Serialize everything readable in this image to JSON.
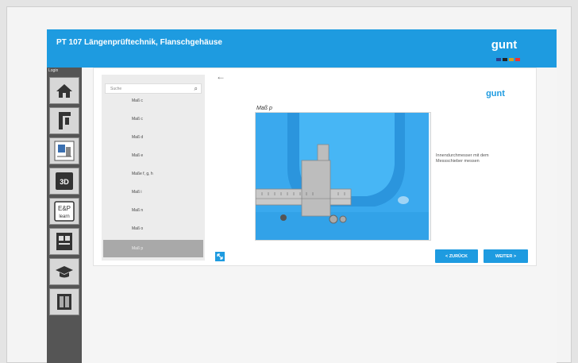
{
  "header": {
    "title": "PT 107 Längenprüftechnik, Flanschgehäuse",
    "logo_text": "gunt"
  },
  "sidebar": {
    "top_label": "Login",
    "items": [
      {
        "icon": "home-icon"
      },
      {
        "icon": "caliper-icon"
      },
      {
        "icon": "drawing-icon"
      },
      {
        "icon": "3d-icon",
        "label": "3D"
      },
      {
        "icon": "elearn-icon",
        "label": "E&P learn"
      },
      {
        "icon": "worksheet-icon"
      },
      {
        "icon": "graduation-cap-icon"
      },
      {
        "icon": "door-icon"
      }
    ]
  },
  "list": {
    "search_placeholder": "Suche",
    "items": [
      "Maß c",
      "Maß c",
      "Maß d",
      "Maß e",
      "Maße f, g, h",
      "Maß i",
      "Maß n",
      "Maß o",
      "Maß p"
    ],
    "active_index": 8
  },
  "detail": {
    "mass_label": "Maß p",
    "description": "Innendurchmesser mit dem Messschieber messen",
    "back_label": "←",
    "prev_label": "< ZURÜCK",
    "next_label": "WEITER >"
  },
  "colors": {
    "accent": "#1e9be0",
    "part_blue": "#3db0f0",
    "sidebar": "#555555"
  }
}
